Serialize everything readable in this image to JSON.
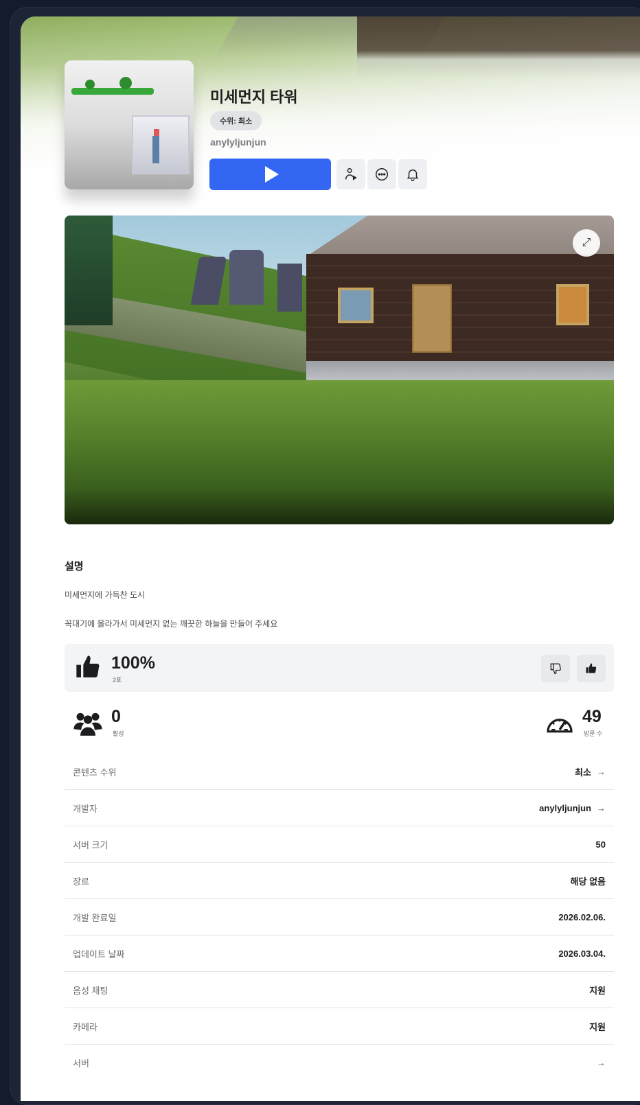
{
  "game": {
    "title": "미세먼지 타워",
    "maturity_pill": "수위: 최소",
    "creator": "anylyljunjun"
  },
  "actions": {
    "play_icon": "play-icon",
    "buttons": [
      "person-play-icon",
      "more-icon",
      "bell-icon"
    ]
  },
  "media": {
    "expand_icon": "⤢"
  },
  "description": {
    "heading": "설명",
    "lines": [
      "미세먼지에 가득찬 도시",
      "꼭대기에 올라가서 미세먼지 없는 깨끗한 하늘을 만들어 주세요"
    ]
  },
  "rating": {
    "percent": "100%",
    "votes": "2표"
  },
  "stats": {
    "active_value": "0",
    "active_label": "활성",
    "visits_value": "49",
    "visits_label": "방문 수"
  },
  "info_rows": [
    {
      "key": "콘텐츠 수위",
      "value": "최소",
      "arrow": "→"
    },
    {
      "key": "개발자",
      "value": "anylyljunjun",
      "arrow": "→"
    },
    {
      "key": "서버 크기",
      "value": "50",
      "arrow": ""
    },
    {
      "key": "장르",
      "value": "해당 없음",
      "arrow": ""
    },
    {
      "key": "개발 완료일",
      "value": "2026.02.06.",
      "arrow": ""
    },
    {
      "key": "업데이트 날짜",
      "value": "2026.03.04.",
      "arrow": ""
    },
    {
      "key": "음성 채팅",
      "value": "지원",
      "arrow": ""
    },
    {
      "key": "카메라",
      "value": "지원",
      "arrow": ""
    },
    {
      "key": "서버",
      "value": "",
      "arrow": "→"
    }
  ],
  "colors": {
    "play_button": "#3366f2",
    "background": "#141b2a"
  }
}
